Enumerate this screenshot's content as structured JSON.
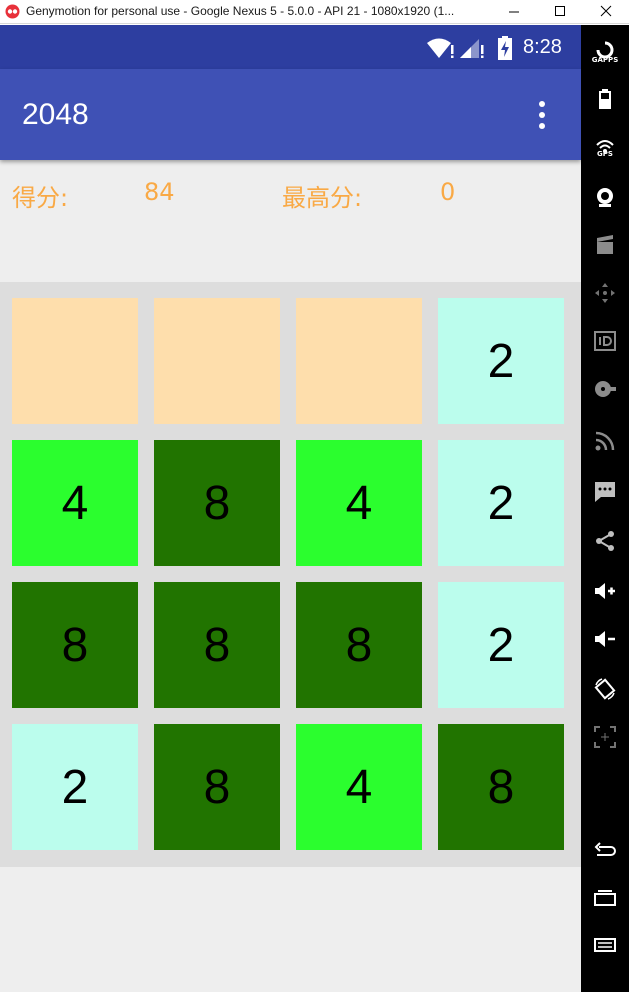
{
  "window": {
    "title": "Genymotion for personal use - Google Nexus 5 - 5.0.0 - API 21 - 1080x1920 (1..."
  },
  "status_bar": {
    "time": "8:28"
  },
  "app": {
    "title": "2048"
  },
  "score": {
    "label": "得分:",
    "value": "84",
    "best_label": "最高分:",
    "best_value": "0"
  },
  "board": {
    "tiles": [
      {
        "value": "",
        "color": "#fedeac"
      },
      {
        "value": "",
        "color": "#fedeac"
      },
      {
        "value": "",
        "color": "#fedeac"
      },
      {
        "value": "2",
        "color": "#bbfded"
      },
      {
        "value": "4",
        "color": "#2bfe2e"
      },
      {
        "value": "8",
        "color": "#217400"
      },
      {
        "value": "4",
        "color": "#2bfe2e"
      },
      {
        "value": "2",
        "color": "#bbfded"
      },
      {
        "value": "8",
        "color": "#217400"
      },
      {
        "value": "8",
        "color": "#217400"
      },
      {
        "value": "8",
        "color": "#217400"
      },
      {
        "value": "2",
        "color": "#bbfded"
      },
      {
        "value": "2",
        "color": "#bbfded"
      },
      {
        "value": "8",
        "color": "#217400"
      },
      {
        "value": "4",
        "color": "#2bfe2e"
      },
      {
        "value": "8",
        "color": "#217400"
      }
    ]
  },
  "sidebar": {
    "gapps_label": "GAPPS",
    "gps_label": "GPS",
    "items": [
      "gapps-icon",
      "battery-icon",
      "gps-icon",
      "camera-icon",
      "video-icon",
      "dpad-icon",
      "id-icon",
      "disk-icon",
      "rss-icon",
      "sms-icon",
      "share-icon",
      "volume-up-icon",
      "volume-down-icon",
      "rotate-icon",
      "scale-icon",
      "back-icon",
      "recent-apps-icon",
      "menu-icon"
    ]
  },
  "colors": {
    "status_bar": "#2d3ea0",
    "app_bar": "#3f51b5",
    "score_text": "#f9a945",
    "board_bg": "#dddddd",
    "screen_bg": "#eeeeee"
  }
}
